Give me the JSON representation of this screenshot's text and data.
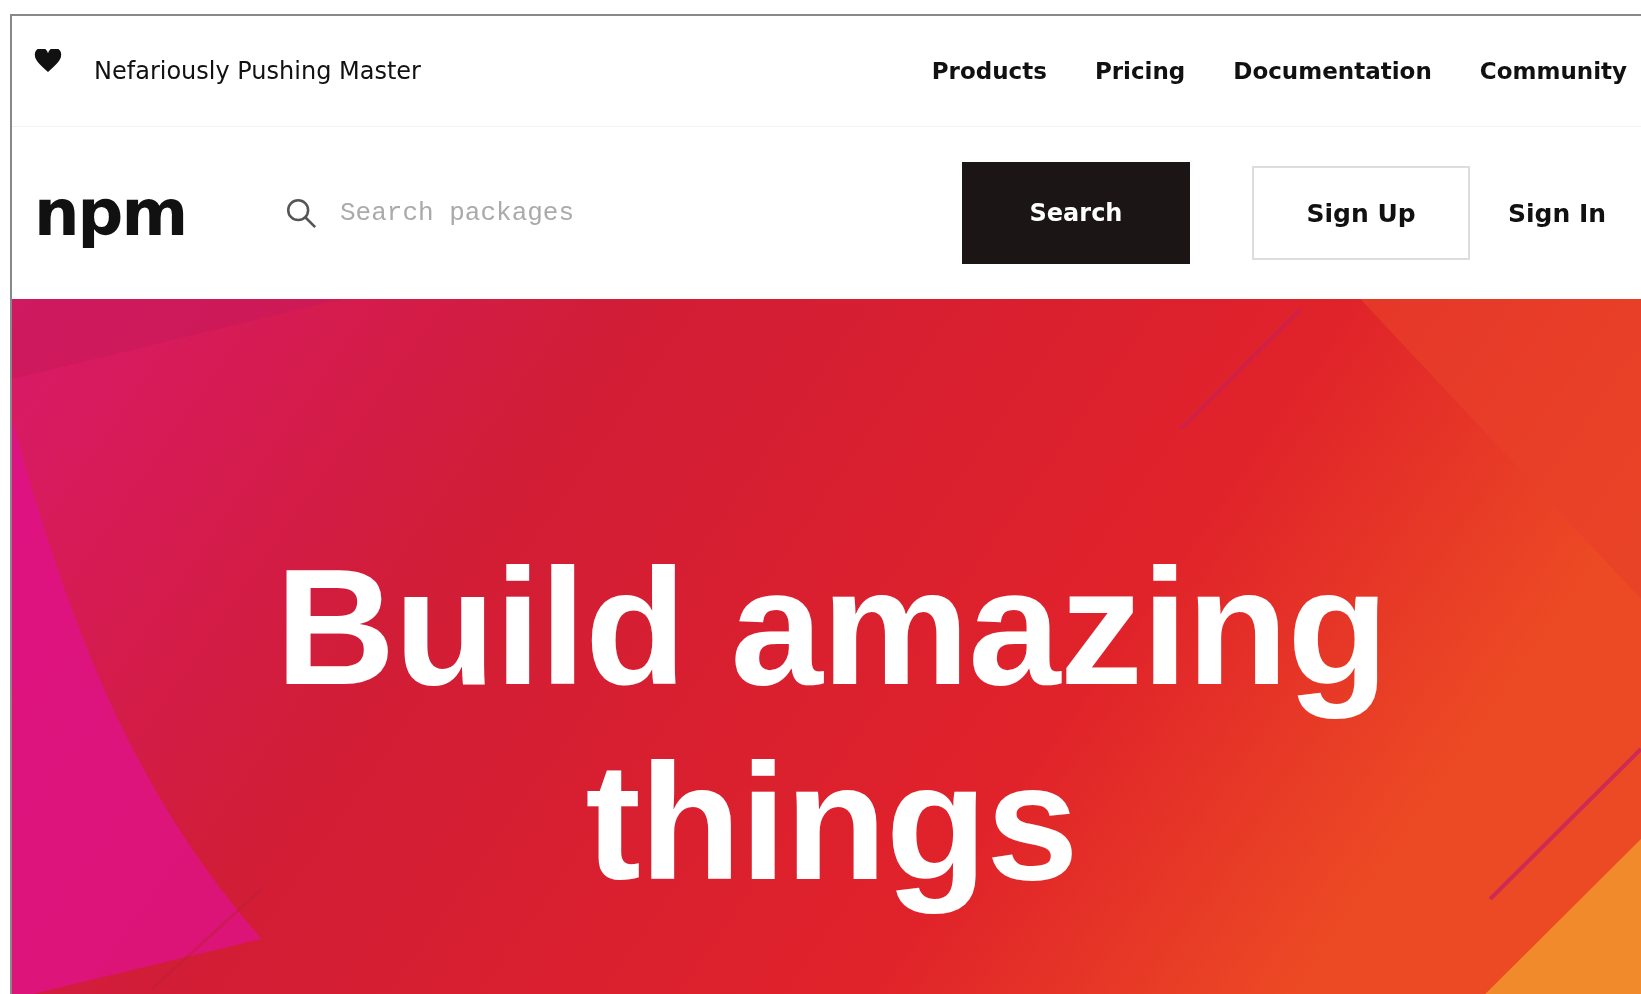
{
  "top_bar": {
    "tagline": "Nefariously Pushing Master",
    "links": [
      "Products",
      "Pricing",
      "Documentation",
      "Community"
    ]
  },
  "header": {
    "logo": "npm",
    "search": {
      "placeholder": "Search packages"
    },
    "search_button": "Search",
    "sign_up": "Sign Up",
    "sign_in": "Sign In"
  },
  "hero": {
    "headline_lines": [
      "Build amazing",
      "things"
    ]
  }
}
